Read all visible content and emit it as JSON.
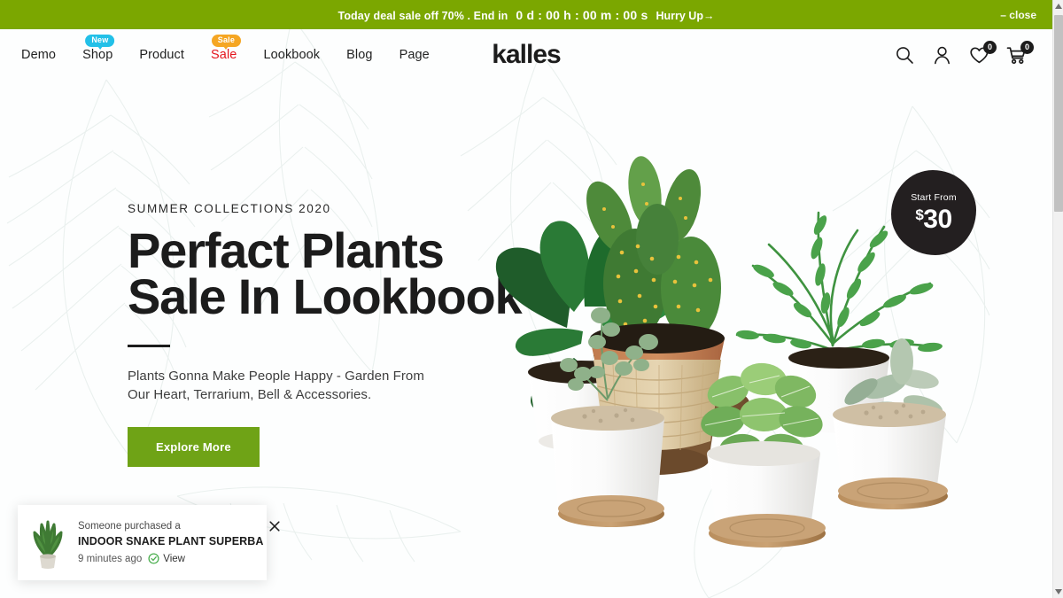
{
  "announcement": {
    "text": "Today deal sale off 70% . End in",
    "countdown": {
      "days": "0 d",
      "hours": "00 h",
      "minutes": "00 m",
      "seconds": "00 s",
      "separator": ":"
    },
    "hurry": "Hurry Up→",
    "close": "– close",
    "background": "#7ba700"
  },
  "header": {
    "logo": "kalles",
    "nav": [
      {
        "label": "Demo",
        "badge": null,
        "highlight": false
      },
      {
        "label": "Shop",
        "badge": "New",
        "badge_color": "#22c0e8",
        "highlight": false
      },
      {
        "label": "Product",
        "badge": null,
        "highlight": false
      },
      {
        "label": "Sale",
        "badge": "Sale",
        "badge_color": "#f5a623",
        "highlight": true,
        "highlight_color": "#e4141c"
      },
      {
        "label": "Lookbook",
        "badge": null,
        "highlight": false
      },
      {
        "label": "Blog",
        "badge": null,
        "highlight": false
      },
      {
        "label": "Page",
        "badge": null,
        "highlight": false
      }
    ],
    "icons": [
      {
        "name": "search-icon",
        "count": null
      },
      {
        "name": "account-icon",
        "count": null
      },
      {
        "name": "wishlist-heart-icon",
        "count": "0"
      },
      {
        "name": "cart-icon",
        "count": "0"
      }
    ]
  },
  "hero": {
    "eyebrow": "SUMMER COLLECTIONS 2020",
    "title_line1": "Perfact Plants",
    "title_line2": "Sale In Lookbook",
    "subtitle": "Plants Gonna Make People Happy - Garden From Our Heart, Terrarium, Bell & Accessories.",
    "cta_label": "Explore More",
    "cta_color": "#6fa316",
    "price_badge": {
      "label": "Start From",
      "currency": "$",
      "amount": "30"
    }
  },
  "popup": {
    "line1": "Someone purchased a",
    "product": "INDOOR SNAKE PLANT SUPERBA",
    "time": "9 minutes ago",
    "view_label": "View",
    "view_color": "#4caf50",
    "thumb_alt": "snake-plant-thumbnail"
  }
}
